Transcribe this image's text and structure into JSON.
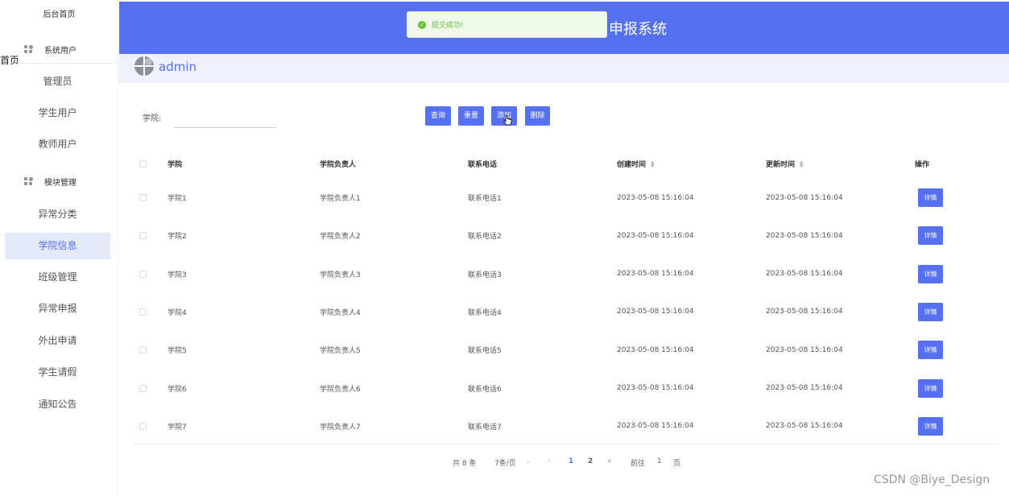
{
  "sidebar": {
    "home": "后台首页",
    "stray_text": "首页",
    "groups": [
      {
        "label": "系统用户",
        "icon": "grid-icon"
      },
      {
        "label": "模块管理",
        "icon": "grid-icon"
      }
    ],
    "items": [
      "管理员",
      "学生用户",
      "教师用户",
      "异常分类",
      "学院信息",
      "班级管理",
      "异常申报",
      "外出申请",
      "学生请假",
      "通知公告"
    ],
    "active_item": "学院信息"
  },
  "header": {
    "title": "申报系统",
    "bg_color": "#5570f1"
  },
  "toast": {
    "message": "提交成功!",
    "icon": "check-circle-icon"
  },
  "user": {
    "name": "admin",
    "avatar_icon": "avatar-icon"
  },
  "search": {
    "label": "学院:",
    "value": "",
    "placeholder": ""
  },
  "toolbar": {
    "query": "查询",
    "reset": "重置",
    "add": "添加",
    "delete": "删除"
  },
  "table": {
    "headers": {
      "college": "学院",
      "leader": "学院负责人",
      "phone": "联系电话",
      "created": "创建时间",
      "updated": "更新时间",
      "ops": "操作"
    },
    "rows": [
      {
        "college": "学院1",
        "leader": "学院负责人1",
        "phone": "联系电话1",
        "created": "2023-05-08 15:16:04",
        "updated": "2023-05-08 15:16:04",
        "detail": "详情"
      },
      {
        "college": "学院2",
        "leader": "学院负责人2",
        "phone": "联系电话2",
        "created": "2023-05-08 15:16:04",
        "updated": "2023-05-08 15:16:04",
        "detail": "详情"
      },
      {
        "college": "学院3",
        "leader": "学院负责人3",
        "phone": "联系电话3",
        "created": "2023-05-08 15:16:04",
        "updated": "2023-05-08 15:16:04",
        "detail": "详情"
      },
      {
        "college": "学院4",
        "leader": "学院负责人4",
        "phone": "联系电话4",
        "created": "2023-05-08 15:16:04",
        "updated": "2023-05-08 15:16:04",
        "detail": "详情"
      },
      {
        "college": "学院5",
        "leader": "学院负责人5",
        "phone": "联系电话5",
        "created": "2023-05-08 15:16:04",
        "updated": "2023-05-08 15:16:04",
        "detail": "详情"
      },
      {
        "college": "学院6",
        "leader": "学院负责人6",
        "phone": "联系电话6",
        "created": "2023-05-08 15:16:04",
        "updated": "2023-05-08 15:16:04",
        "detail": "详情"
      },
      {
        "college": "学院7",
        "leader": "学院负责人7",
        "phone": "联系电话7",
        "created": "2023-05-08 15:16:04",
        "updated": "2023-05-08 15:16:04",
        "detail": "详情"
      }
    ]
  },
  "pagination": {
    "total": "共 8 条",
    "page_size": "7条/页",
    "pages": [
      "1",
      "2"
    ],
    "current_page": "1",
    "goto_prefix": "前往",
    "goto_value": "1",
    "goto_suffix": "页"
  },
  "watermark": "CSDN @Biye_Design"
}
